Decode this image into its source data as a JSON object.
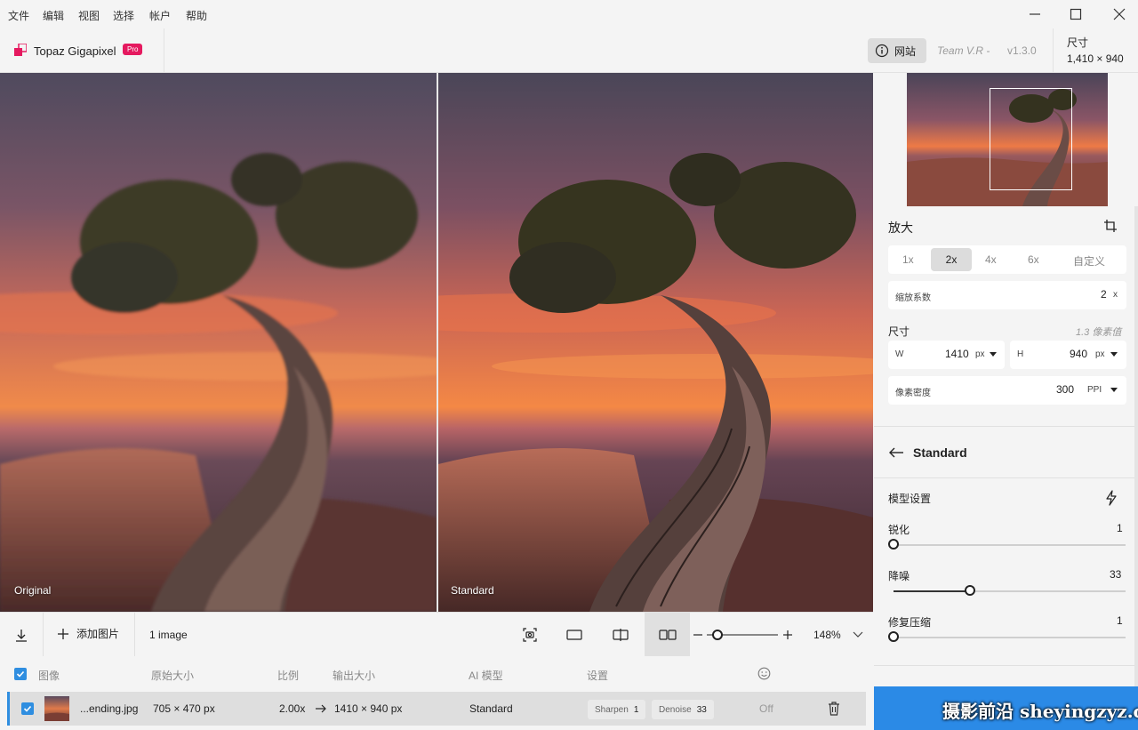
{
  "menu": [
    "文件",
    "编辑",
    "视图",
    "选择",
    "帐户",
    "帮助"
  ],
  "header": {
    "app_name": "Topaz Gigapixel",
    "badge": "Pro",
    "website_button": "网站",
    "team": "Team V.R -",
    "version": "v1.3.0",
    "size_label": "尺寸",
    "size_value": "1,410 × 940"
  },
  "viewer": {
    "left_label": "Original",
    "right_label": "Standard"
  },
  "toolbar": {
    "add_image": "添加图片",
    "image_count": "1 image",
    "zoom": "148%",
    "zoom_level": 0.15
  },
  "list": {
    "headers": {
      "image": "图像",
      "original_size": "原始大小",
      "ratio": "比例",
      "output_size": "输出大小",
      "ai_model": "AI 模型",
      "settings": "设置"
    },
    "row": {
      "filename": "...ending.jpg",
      "original_size": "705 × 470 px",
      "ratio": "2.00x",
      "output_size": "1410 × 940 px",
      "model": "Standard",
      "sharpen_label": "Sharpen",
      "sharpen_value": "1",
      "denoise_label": "Denoise",
      "denoise_value": "33",
      "status": "Off"
    }
  },
  "panel": {
    "upscale_title": "放大",
    "scales": [
      "1x",
      "2x",
      "4x",
      "6x",
      "自定义"
    ],
    "selected_scale": "2x",
    "scale_factor_label": "缩放系数",
    "scale_factor_value": "2",
    "scale_factor_unit": "x",
    "dimensions_title": "尺寸",
    "megapixels": "1.3 像素值",
    "width_label": "W",
    "width_value": "1410",
    "width_unit": "px",
    "height_label": "H",
    "height_value": "940",
    "height_unit": "px",
    "density_label": "像素密度",
    "density_value": "300",
    "density_unit": "PPI",
    "model_name": "Standard",
    "model_settings_title": "模型设置",
    "sharpen_label": "锐化",
    "sharpen_value": "1",
    "denoise_label": "降噪",
    "denoise_value": "33",
    "compression_label": "修复压缩",
    "compression_value": "1"
  },
  "watermark": "摄影前沿 sheyingzyz.com",
  "colors": {
    "accent": "#2f8ee0",
    "badge": "#e5195f",
    "export_bar": "#2b8ae6"
  }
}
